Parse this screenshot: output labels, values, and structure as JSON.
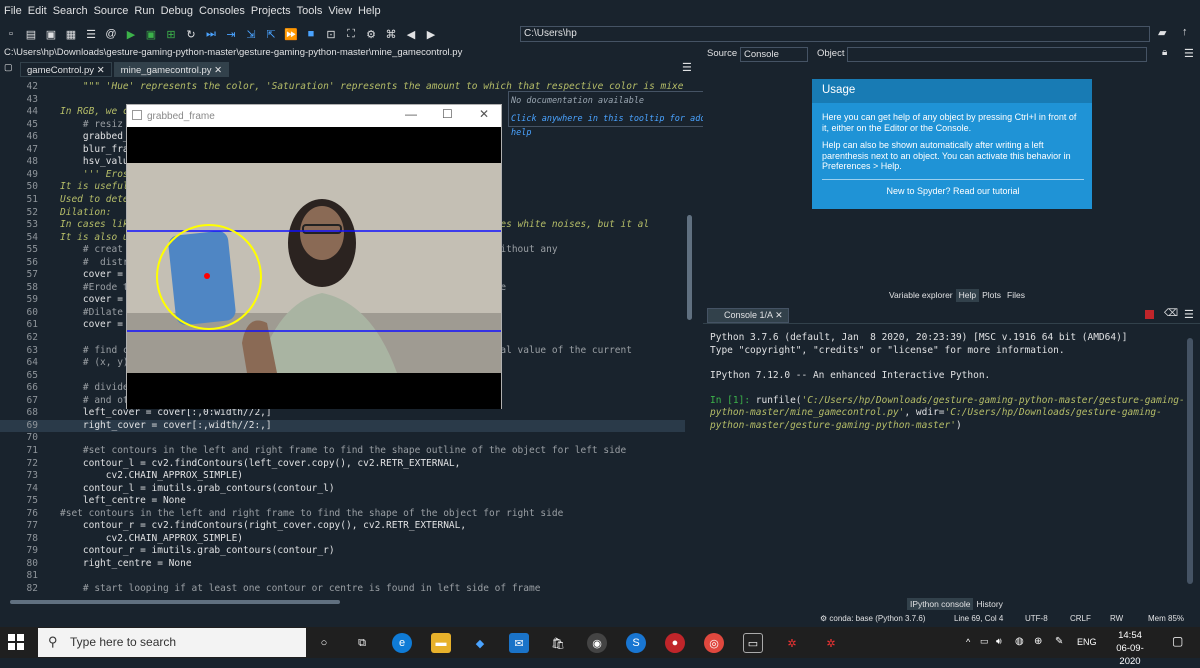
{
  "menubar": [
    "File",
    "Edit",
    "Search",
    "Source",
    "Run",
    "Debug",
    "Consoles",
    "Projects",
    "Tools",
    "View",
    "Help"
  ],
  "toolbar": {
    "working_dir": "C:\\Users\\hp"
  },
  "editor": {
    "file_path": "C:\\Users\\hp\\Downloads\\gesture-gaming-python-master\\gesture-gaming-python-master\\mine_gamecontrol.py",
    "tabs": [
      "gameControl.py",
      "mine_gamecontrol.py"
    ],
    "lines": [
      {
        "n": "42",
        "t": "    \"\"\" 'Hue' represents the color, 'Saturation' represents the amount to which that respective color is mixe",
        "c": "doc"
      },
      {
        "n": "43",
        "t": "",
        "c": "code"
      },
      {
        "n": "44",
        "t": "In RGB, we c",
        "c": "doc"
      },
      {
        "n": "45",
        "t": "    # resiz",
        "c": "comment"
      },
      {
        "n": "46",
        "t": "    grabbed_",
        "c": "code"
      },
      {
        "n": "47",
        "t": "    blur_fra",
        "c": "code"
      },
      {
        "n": "48",
        "t": "    hsv_valu",
        "c": "code"
      },
      {
        "n": "49",
        "t": "    ''' Eros",
        "c": "doc"
      },
      {
        "n": "50",
        "t": "It is useful",
        "c": "doc"
      },
      {
        "n": "51",
        "t": "Used to dete",
        "c": "doc"
      },
      {
        "n": "52",
        "t": "Dilation:",
        "c": "doc"
      },
      {
        "n": "53",
        "t": "In cases lik                                                            removes white noises, but it al",
        "c": "doc"
      },
      {
        "n": "54",
        "t": "It is also u",
        "c": "doc"
      },
      {
        "n": "55",
        "t": "    # creat                                                               y without any",
        "c": "comment"
      },
      {
        "n": "56",
        "t": "    #  distr",
        "c": "comment"
      },
      {
        "n": "57",
        "t": "    cover =",
        "c": "code"
      },
      {
        "n": "58",
        "t": "    #Erode t                                                              mage",
        "c": "comment"
      },
      {
        "n": "59",
        "t": "    cover =",
        "c": "code"
      },
      {
        "n": "60",
        "t": "    #Dilate",
        "c": "comment"
      },
      {
        "n": "61",
        "t": "    cover =",
        "c": "code"
      },
      {
        "n": "62",
        "t": "",
        "c": "code"
      },
      {
        "n": "63",
        "t": "    # find c                                                              itial value of the current",
        "c": "comment"
      },
      {
        "n": "64",
        "t": "    # (x, y)",
        "c": "comment"
      },
      {
        "n": "65",
        "t": "",
        "c": "code"
      },
      {
        "n": "66",
        "t": "    # divide",
        "c": "comment"
      },
      {
        "n": "67",
        "t": "    # and ot",
        "c": "comment"
      },
      {
        "n": "68",
        "t": "    left_cover = cover[:,0:width//2,]",
        "c": "code"
      },
      {
        "n": "69",
        "t": "    right_cover = cover[:,width//2:,]",
        "c": "code"
      },
      {
        "n": "70",
        "t": "",
        "c": "code"
      },
      {
        "n": "71",
        "t": "    #set contours in the left and right frame to find the shape outline of the object for left side",
        "c": "comment"
      },
      {
        "n": "72",
        "t": "    contour_l = cv2.findContours(left_cover.copy(), cv2.RETR_EXTERNAL,",
        "c": "code"
      },
      {
        "n": "73",
        "t": "        cv2.CHAIN_APPROX_SIMPLE)",
        "c": "code"
      },
      {
        "n": "74",
        "t": "    contour_l = imutils.grab_contours(contour_l)",
        "c": "code"
      },
      {
        "n": "75",
        "t": "    left_centre = None",
        "c": "code"
      },
      {
        "n": "76",
        "t": "#set contours in the left and right frame to find the shape of the object for right side",
        "c": "comment"
      },
      {
        "n": "77",
        "t": "    contour_r = cv2.findContours(right_cover.copy(), cv2.RETR_EXTERNAL,",
        "c": "code"
      },
      {
        "n": "78",
        "t": "        cv2.CHAIN_APPROX_SIMPLE)",
        "c": "code"
      },
      {
        "n": "79",
        "t": "    contour_r = imutils.grab_contours(contour_r)",
        "c": "code"
      },
      {
        "n": "80",
        "t": "    right_centre = None",
        "c": "code"
      },
      {
        "n": "81",
        "t": "",
        "c": "code"
      },
      {
        "n": "82",
        "t": "    # start looping if at least one contour or centre is found in left side of frame",
        "c": "comment"
      }
    ],
    "current_line": "69"
  },
  "tooltip": {
    "line1": "No documentation available",
    "line2": "Click anywhere in this tooltip for additional help"
  },
  "camera_window": {
    "title": "grabbed_frame"
  },
  "help": {
    "source_label": "Source",
    "source_value": "Console",
    "object_label": "Object",
    "usage_title": "Usage",
    "usage_p1": "Here you can get help of any object by pressing Ctrl+I in front of it, either on the Editor or the Console.",
    "usage_p2": "Help can also be shown automatically after writing a left parenthesis next to an object. You can activate this behavior in Preferences > Help.",
    "usage_p3": "New to Spyder? Read our tutorial",
    "tabs": [
      "Variable explorer",
      "Help",
      "Plots",
      "Files"
    ]
  },
  "console": {
    "tab": "Console 1/A",
    "lines": [
      "Python 3.7.6 (default, Jan  8 2020, 20:23:39) [MSC v.1916 64 bit (AMD64)]",
      "Type \"copyright\", \"credits\" or \"license\" for more information.",
      "",
      "IPython 7.12.0 -- An enhanced Interactive Python.",
      ""
    ],
    "prompt": "In [1]:",
    "command": " runfile(",
    "arg1": "'C:/Users/hp/Downloads/gesture-gaming-python-master/gesture-gaming-",
    "arg2": "python-master/mine_gamecontrol.py'",
    "wdir_label": ", wdir=",
    "arg3": "'C:/Users/hp/Downloads/gesture-gaming-",
    "arg4": "python-master/gesture-gaming-python-master'",
    "close": ")",
    "bottom_tabs": [
      "IPython console",
      "History"
    ]
  },
  "statusbar": {
    "conda": "conda: base (Python 3.7.6)",
    "position": "Line 69, Col 4",
    "encoding": "UTF-8",
    "eol": "CRLF",
    "rw": "RW",
    "mem": "Mem 85%"
  },
  "taskbar": {
    "search_placeholder": "Type here to search",
    "lang": "ENG",
    "time": "14:54",
    "date": "06-09-2020"
  }
}
